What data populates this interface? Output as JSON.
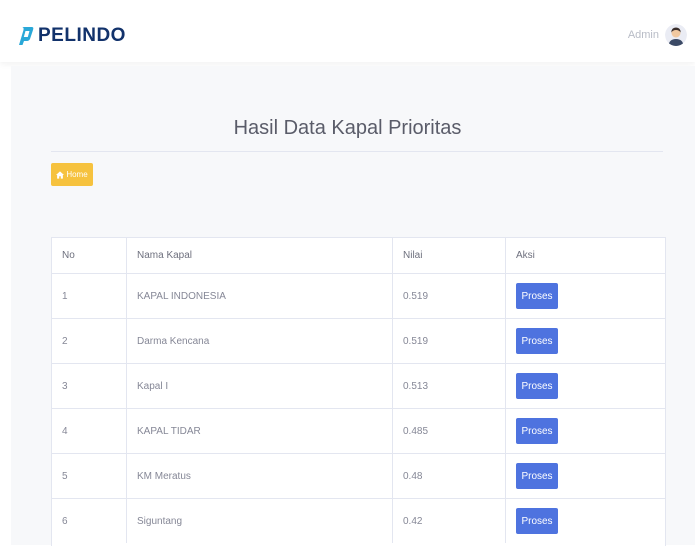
{
  "header": {
    "logo_text": "PELINDO",
    "logo_color": "#12326b",
    "user_name": "Admin"
  },
  "page": {
    "title": "Hasil Data Kapal Prioritas",
    "home_label": "Home",
    "home_color": "#f6c23e"
  },
  "table": {
    "headers": [
      "No",
      "Nama Kapal",
      "Nilai",
      "Aksi"
    ],
    "rows": [
      {
        "no": "1",
        "nama": "KAPAL INDONESIA",
        "nilai": "0.519",
        "aksi": "Proses"
      },
      {
        "no": "2",
        "nama": "Darma Kencana",
        "nilai": "0.519",
        "aksi": "Proses"
      },
      {
        "no": "3",
        "nama": "Kapal I",
        "nilai": "0.513",
        "aksi": "Proses"
      },
      {
        "no": "4",
        "nama": "KAPAL TIDAR",
        "nilai": "0.485",
        "aksi": "Proses"
      },
      {
        "no": "5",
        "nama": "KM Meratus",
        "nilai": "0.48",
        "aksi": "Proses"
      },
      {
        "no": "6",
        "nama": "Siguntang",
        "nilai": "0.42",
        "aksi": "Proses"
      }
    ],
    "action_button_color": "#4e73df"
  }
}
